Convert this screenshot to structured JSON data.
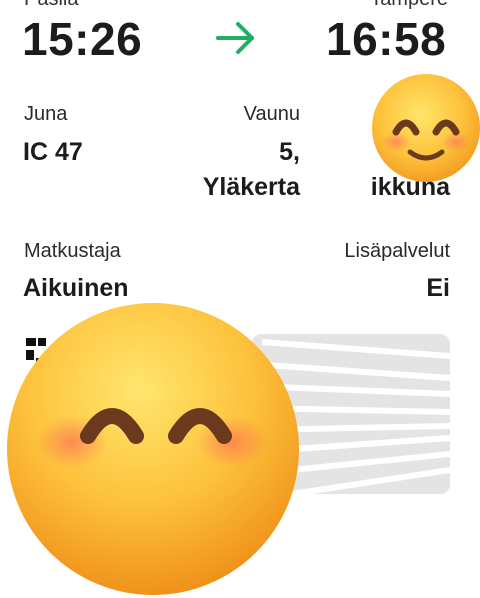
{
  "journey": {
    "from_label": "Pasila",
    "to_label": "Tampere",
    "departure_time": "15:26",
    "arrival_time": "16:58"
  },
  "details": {
    "train_label": "Juna",
    "train_value": "IC 47",
    "car_label": "Vaunu",
    "car_value_line1": "5,",
    "car_value_line2": "Yläkerta",
    "seat_value_partial": "ikkuna",
    "passenger_label": "Matkustaja",
    "passenger_value": "Aikuinen",
    "extras_label": "Lisäpalvelut",
    "extras_value": "Ei"
  },
  "colors": {
    "arrow": "#1fae63",
    "text": "#1c1c1c"
  },
  "icons": {
    "arrow": "arrow-right-icon",
    "emoji": "smiling-face-emoji"
  }
}
